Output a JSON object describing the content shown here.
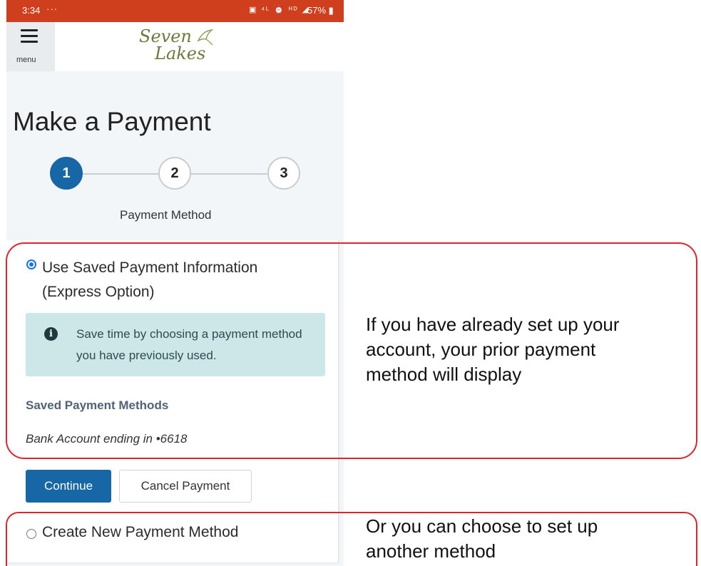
{
  "status_bar": {
    "time": "3:34",
    "dots": "···",
    "icons": "▣ ⁴ᴸ ⏰ ᴴᴰ ◢",
    "battery": "57%"
  },
  "header": {
    "menu_label": "menu",
    "logo_line1": "Seven",
    "logo_line2": "Lakes"
  },
  "page_title": "Make a Payment",
  "steps": [
    "1",
    "2",
    "3"
  ],
  "active_step_label": "Payment Method",
  "option_saved": {
    "label_line1": "Use Saved Payment Information",
    "label_line2": "(Express Option)"
  },
  "info_alert": {
    "text": "Save time by choosing a payment method you have previously used."
  },
  "saved_methods": {
    "heading": "Saved Payment Methods",
    "items": [
      "Bank Account ending in •6618"
    ]
  },
  "buttons": {
    "continue": "Continue",
    "cancel": "Cancel Payment"
  },
  "option_new": {
    "label": "Create New Payment Method"
  },
  "annotations": {
    "note1_line1": "If you have already set up your",
    "note1_line2": "account, your prior payment",
    "note1_line3": "method will display",
    "note2_line1": "Or you can choose to set up",
    "note2_line2": "another method"
  },
  "colors": {
    "status_bar": "#cf3f1d",
    "primary": "#1766a6",
    "alert_bg": "#cde7e8",
    "callout": "#e0242c"
  }
}
